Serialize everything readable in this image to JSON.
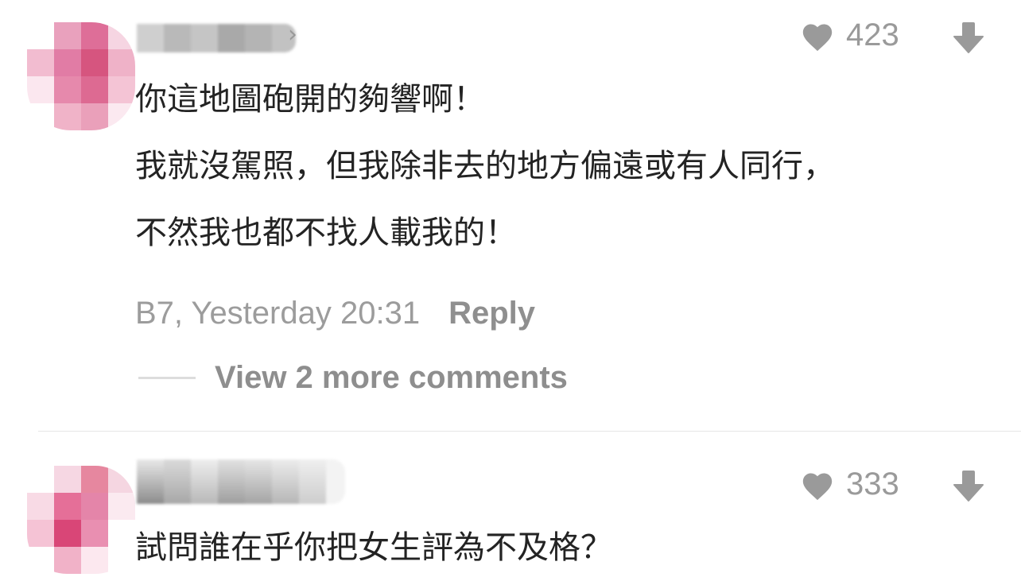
{
  "comments": [
    {
      "likes": "423",
      "text_lines": [
        "你這地圖砲開的夠響啊！",
        "我就沒駕照，但我除非去的地方偏遠或有人同行，",
        "不然我也都不找人載我的！"
      ],
      "floor_time": "B7, Yesterday 20:31",
      "reply_label": "Reply",
      "view_more": "View 2 more comments"
    },
    {
      "likes": "333",
      "text_lines": [
        "試問誰在乎你把女生評為不及格？"
      ]
    }
  ],
  "colors": {
    "text": "#232323",
    "meta": "#9c9c9c",
    "icon": "#9a9a9a",
    "divider": "#e6e6e6"
  },
  "icons": [
    "heart-icon",
    "thumb-down-arrow-icon",
    "chevron-right-icon"
  ]
}
